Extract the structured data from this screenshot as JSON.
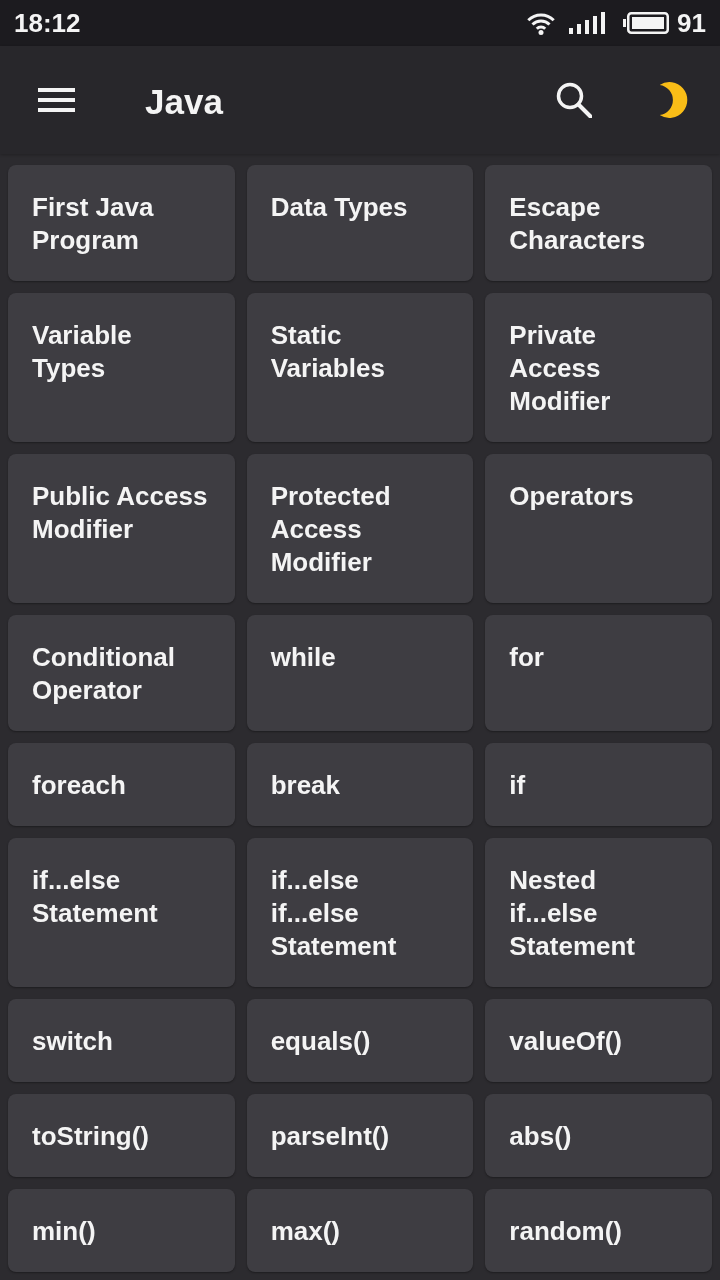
{
  "status_bar": {
    "time": "18:12",
    "battery": "91"
  },
  "app_bar": {
    "title": "Java"
  },
  "topics": [
    "First Java Program",
    "Data Types",
    "Escape Characters",
    "Variable Types",
    "Static Variables",
    "Private Access Modifier",
    "Public Access Modifier",
    "Protected Access Modifier",
    "Operators",
    "Conditional Operator",
    "while",
    "for",
    "foreach",
    "break",
    "if",
    "if...else Statement",
    "if...else if...else Statement",
    "Nested if...else Statement",
    "switch",
    "equals()",
    "valueOf()",
    "toString()",
    "parseInt()",
    "abs()",
    "min()",
    "max()",
    "random()"
  ]
}
